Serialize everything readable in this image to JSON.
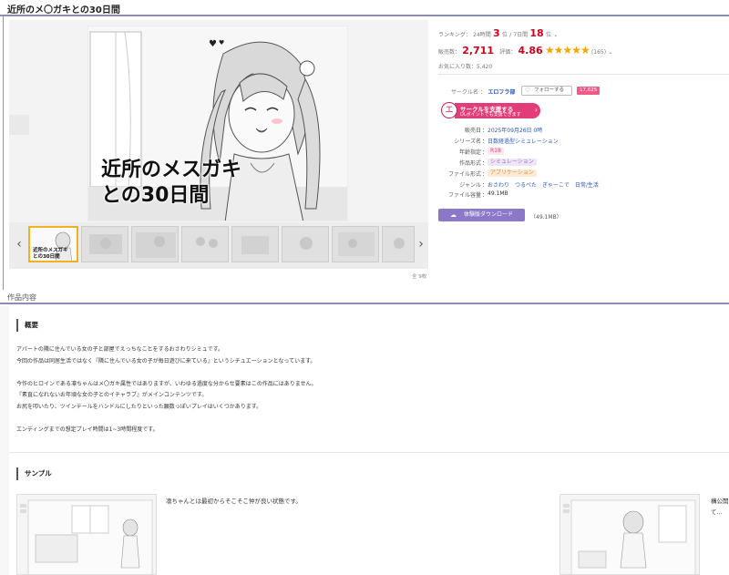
{
  "title": "近所のメ〇ガキとの30日間",
  "cover_title": [
    "近所のメスガキ",
    "との30日間"
  ],
  "thumb_title": [
    "近所のメスガキ",
    "との30日間"
  ],
  "gallery_count": "全 9枚",
  "ranking": {
    "label": "ランキング：",
    "day_label": "24時間",
    "day_rank": "3",
    "day_unit": "位",
    "sep": "/",
    "week_label": "7日間",
    "week_rank": "18",
    "week_unit": "位",
    "chevron": "⌄"
  },
  "sales": {
    "label": "販売数：",
    "value": "2,711",
    "rating_label": "評価：",
    "rating": "4.86",
    "stars": "★★★★★",
    "count": "(165)",
    "chevron": "⌄"
  },
  "favorites": "お気に入り数：5,420",
  "circle": {
    "label": "サークル名",
    "sep": "：",
    "name": "エロフラ部",
    "follow": "フォローする",
    "followers": "17,625"
  },
  "support": {
    "badge": "エ",
    "line1": "サークルを支援する",
    "line2": "DLポイントでも支援できます",
    "chevron": "›"
  },
  "details": [
    {
      "k": "販売日",
      "v": "2025年09月26日 0時",
      "style": "link"
    },
    {
      "k": "シリーズ名",
      "v": "日数経過型シミュレーション",
      "style": "link"
    },
    {
      "k": "年齢指定",
      "v": "R18",
      "style": "pink"
    },
    {
      "k": "作品形式",
      "v": "シミュレーション",
      "style": "purple"
    },
    {
      "k": "ファイル形式",
      "v": "アプリケーション",
      "style": "orange"
    },
    {
      "k": "ジャンル",
      "v": "おさわり　つるぺた　ぎゃーこで　日常/生活",
      "style": "link"
    },
    {
      "k": "ファイル容量",
      "v": "49.1MB",
      "style": "plain"
    }
  ],
  "download": {
    "label": "体験版ダウンロード",
    "size": "（49.1MB）"
  },
  "section_title": "作品内容",
  "overview_title": "概要",
  "description": "アパートの隣に住んでいる女の子と部屋でえっちなことをするおさわりシミュです。\n今回の作品は同居生活ではなく『隣に住んでいる女の子が毎日遊びに来ている』というシチュエーションとなっています。\n\n今作のヒロインである凛ちゃんはメ〇ガキ属性ではありますが、いわゆる過度な分からせ要素はこの作品にはありません。\n『素直になれないお年頃な女の子とのイチャラブ』がメインコンテンツです。\nお尻を叩いたり、ツインテールをハンドルにしたりといった願数っぽいプレイはいくつかあります。\n\nエンディングまでの想定プレイ時間は1~3時間程度です。",
  "sample_title": "サンプル",
  "samples": [
    {
      "caption": "凛ちゃんとは最初からそこそこ仲が良い状態です。"
    },
    {
      "caption": "構公開",
      "caption2": "て..."
    }
  ],
  "icons": {
    "prev": "chevron-left-icon",
    "next": "chevron-right-icon",
    "heart": "heart-icon",
    "cloud": "cloud-download-icon"
  },
  "colors": {
    "accent_red": "#d0021b",
    "star": "#f7a600",
    "support_pink": "#e23d78",
    "download_purple": "#8c78c8",
    "link_blue": "#2a56b8"
  }
}
